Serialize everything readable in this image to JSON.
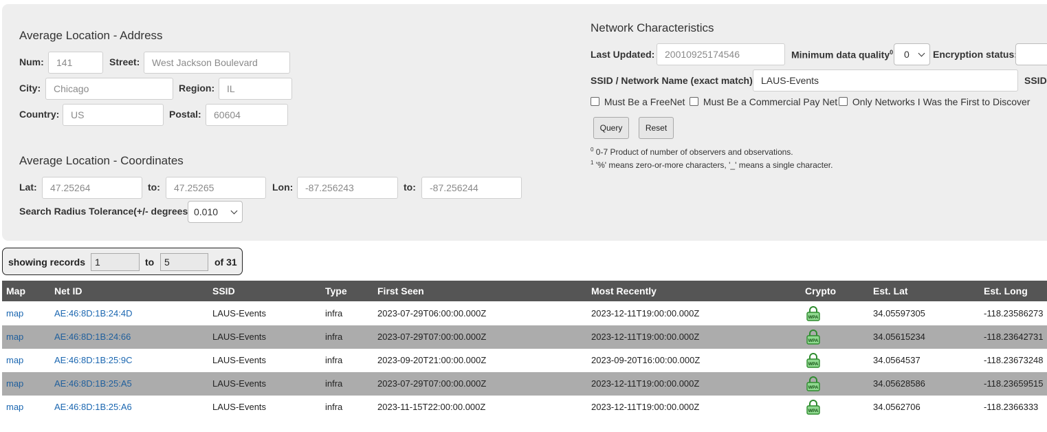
{
  "address": {
    "title": "Average Location - Address",
    "num_label": "Num:",
    "num_placeholder": "141",
    "street_label": "Street:",
    "street_placeholder": "West Jackson Boulevard",
    "city_label": "City:",
    "city_placeholder": "Chicago",
    "region_label": "Region:",
    "region_placeholder": "IL",
    "country_label": "Country:",
    "country_placeholder": "US",
    "postal_label": "Postal:",
    "postal_placeholder": "60604"
  },
  "coords": {
    "title": "Average Location - Coordinates",
    "lat_label": "Lat:",
    "lat_from_placeholder": "47.25264",
    "to_label": "to:",
    "lat_to_placeholder": "47.25265",
    "lon_label": "Lon:",
    "lon_from_placeholder": "-87.256243",
    "lon_to_placeholder": "-87.256244",
    "radius_label": "Search Radius Tolerance(+/- degrees):",
    "radius_value": "0.010"
  },
  "network": {
    "title": "Network Characteristics",
    "last_updated_label": "Last Updated:",
    "last_updated_placeholder": "20010925174546",
    "min_quality_label": "Minimum data quality",
    "min_quality_sup": "0",
    "min_quality_colon": ":",
    "min_quality_value": "0",
    "encryption_label": "Encryption status:",
    "ssid_label": "SSID / Network Name (exact match):",
    "ssid_value": "LAUS-Events",
    "ssid_right_label": "SSID",
    "freenet_label": "Must Be a FreeNet",
    "commercial_label": "Must Be a Commercial Pay Net",
    "first_label": "Only Networks I Was the First to Discover",
    "query_button": "Query",
    "reset_button": "Reset",
    "note0_sup": "0",
    "note0": "0-7 Product of number of observers and observations.",
    "note1_sup": "1",
    "note1": "'%' means zero-or-more characters, '_' means a single character."
  },
  "pager": {
    "showing_label": "showing records",
    "from_value": "1",
    "to_label": "to",
    "to_value": "5",
    "of_label": "of 31"
  },
  "table": {
    "headers": [
      "Map",
      "Net ID",
      "SSID",
      "Type",
      "First Seen",
      "Most Recently",
      "Crypto",
      "Est. Lat",
      "Est. Long"
    ],
    "crypto_icon": "wpa-lock-icon",
    "crypto_color": "#2e8b2e",
    "rows": [
      {
        "map": "map",
        "netid": "AE:46:8D:1B:24:4D",
        "ssid": "LAUS-Events",
        "type": "infra",
        "first": "2023-07-29T06:00:00.000Z",
        "recent": "2023-12-11T19:00:00.000Z",
        "lat": "34.05597305",
        "lon": "-118.23586273"
      },
      {
        "map": "map",
        "netid": "AE:46:8D:1B:24:66",
        "ssid": "LAUS-Events",
        "type": "infra",
        "first": "2023-07-29T07:00:00.000Z",
        "recent": "2023-12-11T19:00:00.000Z",
        "lat": "34.05615234",
        "lon": "-118.23642731"
      },
      {
        "map": "map",
        "netid": "AE:46:8D:1B:25:9C",
        "ssid": "LAUS-Events",
        "type": "infra",
        "first": "2023-09-20T21:00:00.000Z",
        "recent": "2023-09-20T16:00:00.000Z",
        "lat": "34.0564537",
        "lon": "-118.23673248"
      },
      {
        "map": "map",
        "netid": "AE:46:8D:1B:25:A5",
        "ssid": "LAUS-Events",
        "type": "infra",
        "first": "2023-07-29T07:00:00.000Z",
        "recent": "2023-12-11T19:00:00.000Z",
        "lat": "34.05628586",
        "lon": "-118.23659515"
      },
      {
        "map": "map",
        "netid": "AE:46:8D:1B:25:A6",
        "ssid": "LAUS-Events",
        "type": "infra",
        "first": "2023-11-15T22:00:00.000Z",
        "recent": "2023-12-11T19:00:00.000Z",
        "lat": "34.0562706",
        "lon": "-118.2366333"
      }
    ]
  }
}
